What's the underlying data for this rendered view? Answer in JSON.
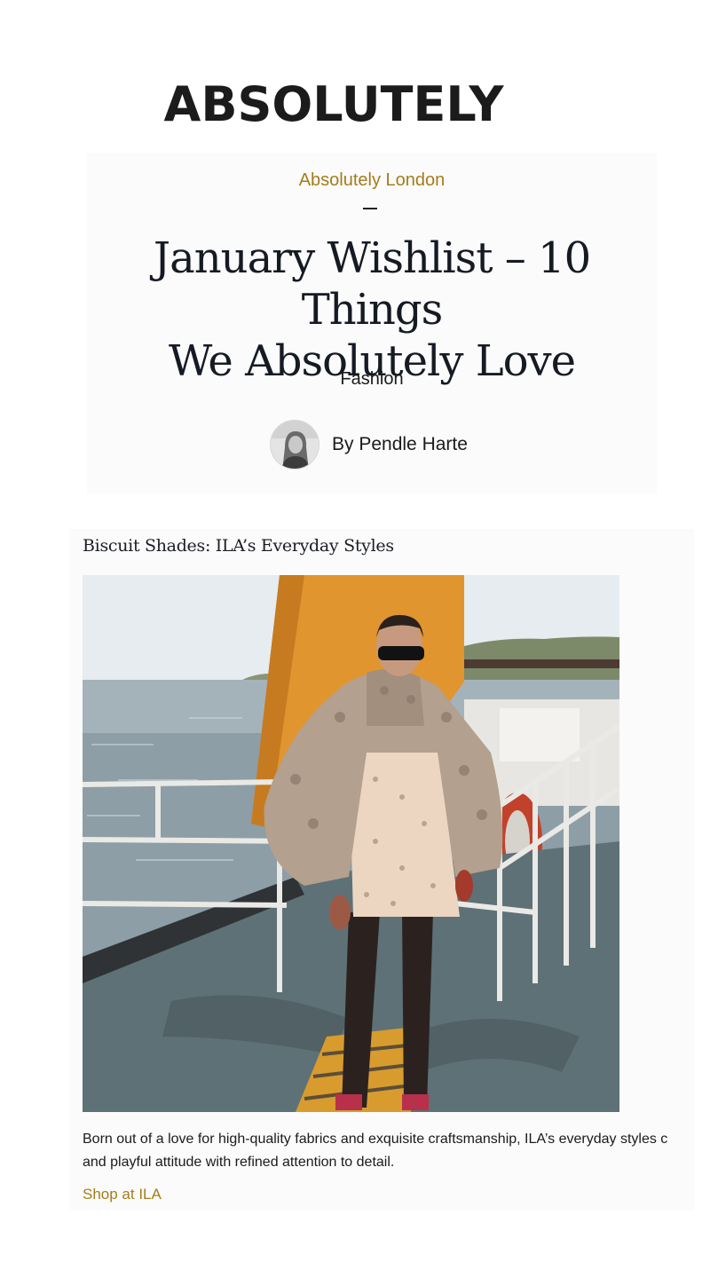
{
  "brand": {
    "logo_text": "ABSOLUTELY"
  },
  "article": {
    "section": "Absolutely London",
    "title_line1": "January Wishlist – 10 Things",
    "title_line2": "We Absolutely Love",
    "category": "Fashion",
    "author": "By Pendle Harte"
  },
  "product": {
    "title": "Biscuit Shades: ILA’s Everyday Styles",
    "description_line1": "Born out of a love for high-quality fabrics and exquisite craftsmanship, ILA’s everyday styles c",
    "description_line2": "and playful attitude with refined attention to detail.",
    "shop_link": "Shop at ILA"
  },
  "colors": {
    "accent_gold": "#a57c1b",
    "text_dark": "#151a23",
    "card_bg": "#fbfbfb"
  }
}
